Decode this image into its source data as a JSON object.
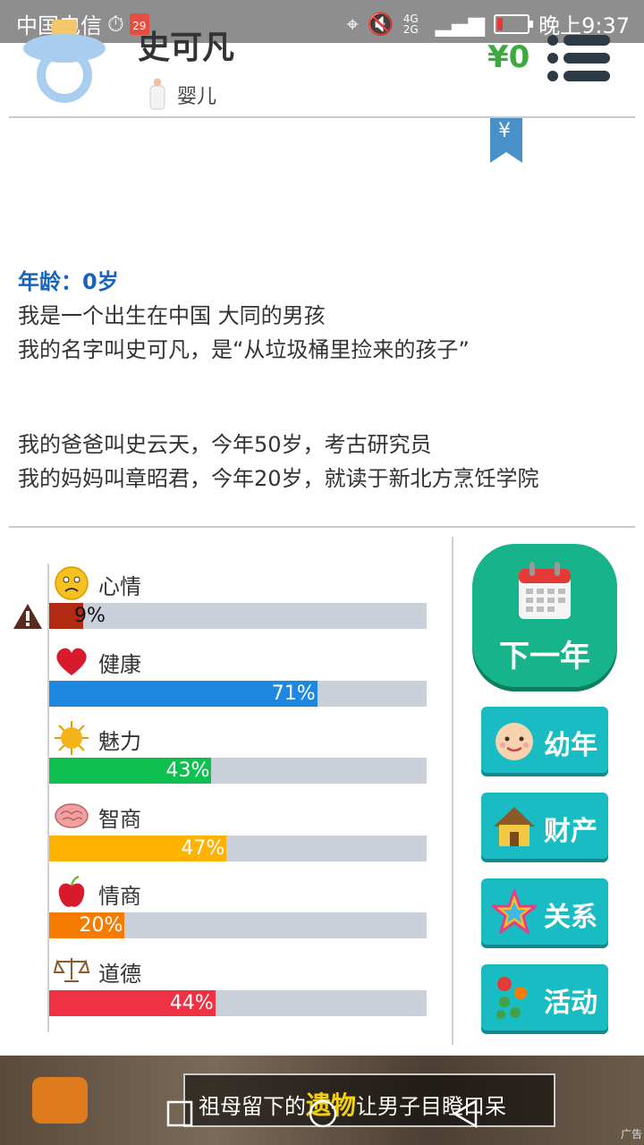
{
  "status_bar": {
    "carrier": "中国电信",
    "calendar_day": "29",
    "network": "4G 2G",
    "time": "晚上9:37"
  },
  "header": {
    "name": "史可凡",
    "stage": "婴儿",
    "money": "¥0",
    "ribbon_symbol": "¥"
  },
  "story": {
    "age_line": "年龄：0岁",
    "lines": [
      "我是一个出生在中国 大同的男孩",
      "我的名字叫史可凡，是“从垃圾桶里捡来的孩子”",
      "",
      "",
      "我的爸爸叫史云天，今年50岁，考古研究员",
      "我的妈妈叫章昭君，今年20岁，就读于新北方烹饪学院"
    ]
  },
  "stats": [
    {
      "label": "心情",
      "value": 9,
      "pct": "9%",
      "color": "#b22a12",
      "icon": "sad-face-icon",
      "warning": true
    },
    {
      "label": "健康",
      "value": 71,
      "pct": "71%",
      "color": "#1e88e0",
      "icon": "heart-icon",
      "warning": false
    },
    {
      "label": "魅力",
      "value": 43,
      "pct": "43%",
      "color": "#0fbf50",
      "icon": "sun-icon",
      "warning": false
    },
    {
      "label": "智商",
      "value": 47,
      "pct": "47%",
      "color": "#ffb300",
      "icon": "brain-icon",
      "warning": false
    },
    {
      "label": "情商",
      "value": 20,
      "pct": "20%",
      "color": "#f57c00",
      "icon": "apple-icon",
      "warning": false
    },
    {
      "label": "道德",
      "value": 44,
      "pct": "44%",
      "color": "#ee3244",
      "icon": "scales-icon",
      "warning": false
    }
  ],
  "actions": {
    "next_year": "下一年",
    "childhood": "幼年",
    "property": "财产",
    "relations": "关系",
    "activities": "活动"
  },
  "ad": {
    "text_before": "祖母留下的",
    "highlight": "遗物",
    "text_after": "让男子目瞪口呆",
    "tag": "广告"
  },
  "colors": {
    "primary_green": "#17b38a",
    "teal": "#19bcc2",
    "money_green": "#3ea93e",
    "age_blue": "#1565c0"
  }
}
